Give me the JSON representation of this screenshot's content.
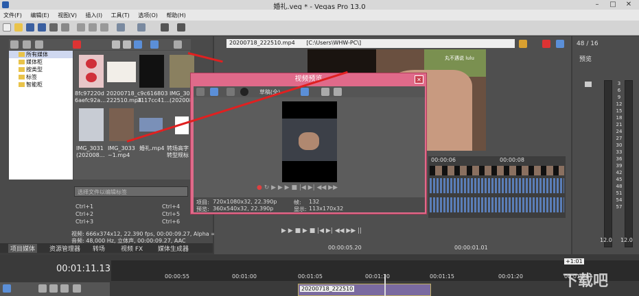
{
  "window": {
    "title": "婚礼.veg * - Vegas Pro 13.0"
  },
  "menu": [
    "文件(F)",
    "编辑(E)",
    "视图(V)",
    "插入(I)",
    "工具(T)",
    "选项(O)",
    "帮助(H)"
  ],
  "explorer": {
    "tree": [
      {
        "label": "所有媒体",
        "selected": true
      },
      {
        "label": "媒体柜"
      },
      {
        "label": "按类型"
      },
      {
        "label": "标签"
      },
      {
        "label": "智能柜"
      }
    ],
    "thumbs": [
      {
        "label": "8fc97220d 6aefc92a…"
      },
      {
        "label": "20200718_ 222510.mp4"
      },
      {
        "label": "c9c616803 3117cc41…"
      },
      {
        "label": "IMG_30… (202008…"
      },
      {
        "label": "IMG_3031 (202008…"
      },
      {
        "label": "IMG_3033 ~1.mp4"
      },
      {
        "label": "婚礼.mp4"
      },
      {
        "label": "转场高字 转型规标"
      }
    ],
    "filter_placeholder": "选择文件以编辑标签",
    "shortcuts": [
      "Ctrl+1",
      "Ctrl+2",
      "Ctrl+3",
      "Ctrl+4",
      "Ctrl+5",
      "Ctrl+6"
    ],
    "info_line1": "视频: 666x374x12, 22.390 fps, 00:00:09.27, Alpha =",
    "info_line2": "音频: 48,000 Hz, 立体声, 00:00:09.27, AAC"
  },
  "tabs": [
    "项目媒体",
    "资源管理器",
    "转场",
    "视频 FX",
    "媒体生成器"
  ],
  "preview_header": {
    "file": "20200718_222510.mp4",
    "path": "[C:\\Users\\WHW-PC\\]"
  },
  "preview_image": {
    "watermark": "丸不遇说 lulu"
  },
  "dialog": {
    "title": "视频预览",
    "mode": "草稿(全)",
    "project_label": "项目:",
    "project_value": "720x1080x32, 22.390p",
    "preview_label": "预览:",
    "preview_value": "360x540x32, 22.390p",
    "frame_label": "帧:",
    "frame_value": "132",
    "display_label": "显示:",
    "display_value": "113x170x32"
  },
  "trimmer": {
    "t1": "00:00:06",
    "t2": "00:00:08",
    "pos": "00:00:05.20",
    "end": "00:00:01.01"
  },
  "meter": {
    "label": "48 / 16",
    "title": "预览",
    "levels": [
      "3",
      "6",
      "9",
      "12",
      "15",
      "18",
      "21",
      "24",
      "27",
      "30",
      "33",
      "36",
      "39",
      "42",
      "45",
      "48",
      "51",
      "54",
      "57"
    ],
    "bottom_left": "12.0",
    "bottom_right": "12.0"
  },
  "timeline": {
    "timecode": "00:01:11.13",
    "marker": "+1:01",
    "ticks": [
      "00:00:55",
      "00:01:00",
      "00:01:05",
      "00:01:10",
      "00:01:15",
      "00:01:20",
      "00:01:25"
    ],
    "clip": "20200718_222510"
  },
  "watermark": "下载吧"
}
